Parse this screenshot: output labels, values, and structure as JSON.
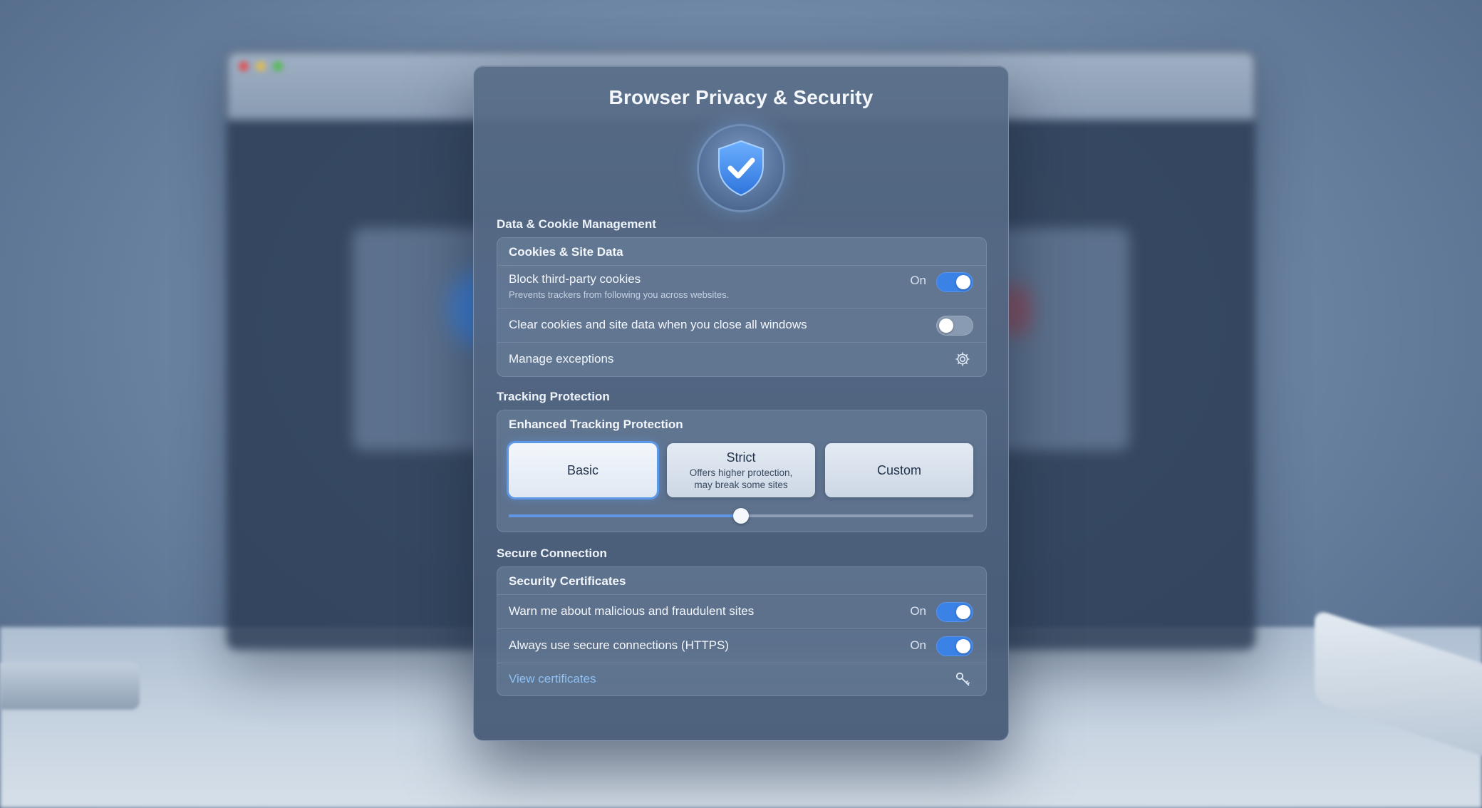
{
  "panel": {
    "title": "Browser Privacy & Security"
  },
  "sections": {
    "data_cookie": {
      "label": "Data & Cookie Management",
      "card_title": "Cookies & Site Data",
      "block_third_party": {
        "title": "Block third-party cookies",
        "subtitle": "Prevents trackers from following you across websites.",
        "state_label": "On",
        "enabled": true
      },
      "clear_on_close": {
        "title": "Clear cookies and site data when you close all windows",
        "enabled": false
      },
      "manage_exceptions": {
        "title": "Manage exceptions",
        "icon": "gear-icon"
      }
    },
    "tracking": {
      "label": "Tracking Protection",
      "card_title": "Enhanced Tracking Protection",
      "options": [
        {
          "title": "Basic",
          "desc": "",
          "selected": true
        },
        {
          "title": "Strict",
          "desc": "Offers higher protection, may break some sites",
          "selected": false
        },
        {
          "title": "Custom",
          "desc": "",
          "selected": false
        }
      ],
      "slider_level": 0.5
    },
    "secure": {
      "label": "Secure Connection",
      "card_title": "Security Certificates",
      "warn_malicious": {
        "title": "Warn me about malicious and fraudulent sites",
        "state_label": "On",
        "enabled": true
      },
      "https_only": {
        "title": "Always use secure connections (HTTPS)",
        "state_label": "On",
        "enabled": true
      },
      "view_certificates": {
        "title": "View certificates",
        "icon": "key-icon"
      }
    }
  },
  "colors": {
    "accent": "#3b82e6",
    "link": "#8fc0f3",
    "shield": "#4b8ff0"
  }
}
